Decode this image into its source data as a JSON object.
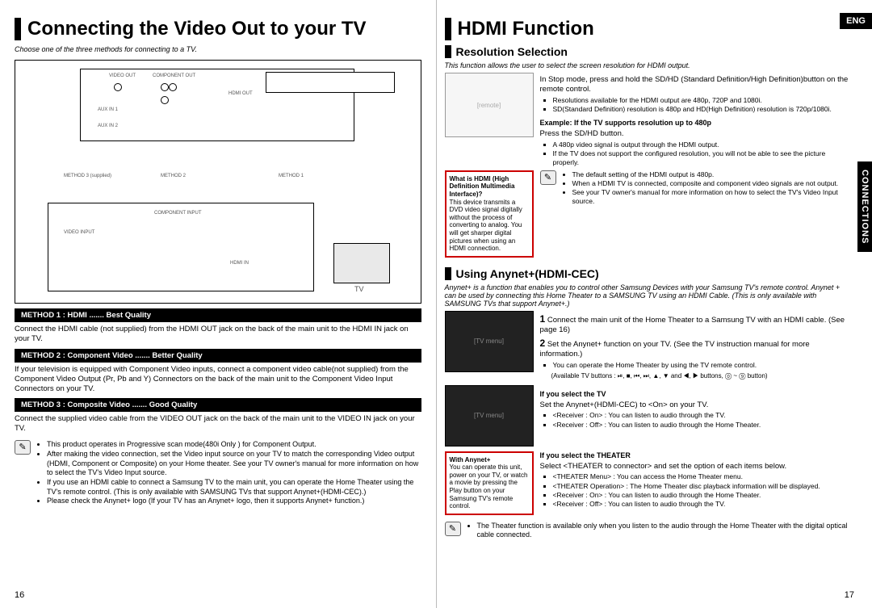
{
  "left": {
    "title": "Connecting the Video Out to your TV",
    "intro": "Choose one of the three methods for connecting to a TV.",
    "diagram": {
      "top_labels": [
        "VIDEO OUT",
        "COMPONENT OUT",
        "HDMI OUT",
        "AUX IN 1",
        "AUX IN 2"
      ],
      "method_tags": [
        "METHOD 3 (supplied)",
        "METHOD 2",
        "METHOD 1"
      ],
      "bottom_labels": [
        "VIDEO INPUT",
        "COMPONENT INPUT",
        "HDMI IN"
      ],
      "tv_caption": "TV"
    },
    "m1_bar": "METHOD 1 : HDMI ....... Best Quality",
    "m1_body": "Connect the HDMI cable (not supplied) from the HDMI OUT jack on the back of the main unit to the HDMI IN jack on your TV.",
    "m2_bar": "METHOD 2 : Component Video ....... Better Quality",
    "m2_body": "If your television is equipped with Component Video inputs, connect a component video cable(not supplied) from the Component Video Output (Pr, Pb and Y) Connectors on the back of the main unit to the Component Video Input Connectors on your TV.",
    "m3_bar": "METHOD 3 : Composite Video ....... Good Quality",
    "m3_body": "Connect the supplied video cable from the VIDEO OUT jack on the back of the main unit to the VIDEO IN jack on your TV.",
    "notes": [
      "This product operates in Progressive scan mode(480i Only ) for Component Output.",
      "After making the video connection, set the Video input source on your TV to match the corresponding Video output (HDMI, Component or Composite) on your Home theater. See your TV owner's manual for more information on how to select the TV's Video Input source.",
      "If you use an HDMI cable to connect a Samsung TV to the main unit, you can operate the Home Theater using the TV's remote control. (This is only available with SAMSUNG TVs that support Anynet+(HDMI-CEC).)",
      "Please check the Anynet+ logo (If your TV has an Anynet+ logo, then it supports Anynet+ function.)"
    ],
    "page_number": "16"
  },
  "right": {
    "title": "HDMI Function",
    "eng_tab": "ENG",
    "side_tab": "CONNECTIONS",
    "resolution": {
      "heading": "Resolution Selection",
      "intro": "This function allows the user to select the screen resolution for HDMI output.",
      "step1": "In Stop mode, press and hold the SD/HD (Standard Definition/High Definition)button on the remote control.",
      "b1": "Resolutions available for the HDMI output are 480p, 720P and 1080i.",
      "b2": "SD(Standard Definition) resolution is 480p and HD(High Definition) resolution is 720p/1080i.",
      "example_line": "Example: If the TV supports resolution up to 480p",
      "press": "Press the SD/HD button.",
      "b3": "A 480p video signal is output through the HDMI output.",
      "b4": "If the TV does not support the configured resolution, you will not be able to see the picture properly.",
      "hdmi_box_title": "What is HDMI (High Definition Multimedia Interface)?",
      "hdmi_box_body": "This device transmits a DVD video signal digitally without the process of converting to analog. You will get sharper digital pictures when using an HDMI connection.",
      "note_items": [
        "The default setting of the HDMI output is 480p.",
        "When a HDMI TV is connected, composite and component video signals are not output.",
        "See your TV owner's manual for more information on how to select the TV's Video Input source."
      ]
    },
    "anynet": {
      "heading": "Using Anynet+(HDMI-CEC)",
      "intro": "Anynet+ is a function that enables you to control other Samsung Devices with your Samsung TV's remote control. Anynet + can be used by connecting this Home Theater to a SAMSUNG TV using an HDMI Cable. (This is only available with SAMSUNG TVs that support Anynet+.)",
      "s1_a": "Connect the main unit of the Home Theater to a Samsung TV with an HDMI cable. (See page 16)",
      "s2_a": "Set the Anynet+ function on your TV. (See the TV instruction manual for more information.)",
      "s2_b": "You can operate the Home Theater by using the TV remote control.",
      "s2_c": "(Available TV buttons : ⏯, ■, ⏮, ⏭, ▲, ▼ and ◀, ▶ buttons, ⓪ ~ ⑨ button)",
      "if_tv_head": "If you select the TV",
      "if_tv_body": "Set the Anynet+(HDMI-CEC) to <On> on your TV.",
      "if_tv_b1": "<Receiver : On>  : You can listen to audio through the TV.",
      "if_tv_b2": "<Receiver : Off>  : You can listen to audio through the Home Theater.",
      "if_th_head": "If you select the THEATER",
      "if_th_body": "Select <THEATER to connector> and set the option of each items below.",
      "if_th_b1": "<THEATER Menu>  : You can access the Home Theater menu.",
      "if_th_b2": "<THEATER Operation>  : The Home Theater disc playback information will be displayed.",
      "if_th_b3": "<Receiver : On>  : You can listen to audio through the Home Theater.",
      "if_th_b4": "<Receiver : Off>  : You can listen to audio through the TV.",
      "with_box_title": "With Anynet+",
      "with_box_body": "You can operate this unit, power on your TV, or watch a movie by pressing the Play button on your Samsung TV's remote control.",
      "final_note": "The Theater function is available only when you listen to the audio through the Home Theater with the digital optical cable connected."
    },
    "page_number": "17"
  }
}
